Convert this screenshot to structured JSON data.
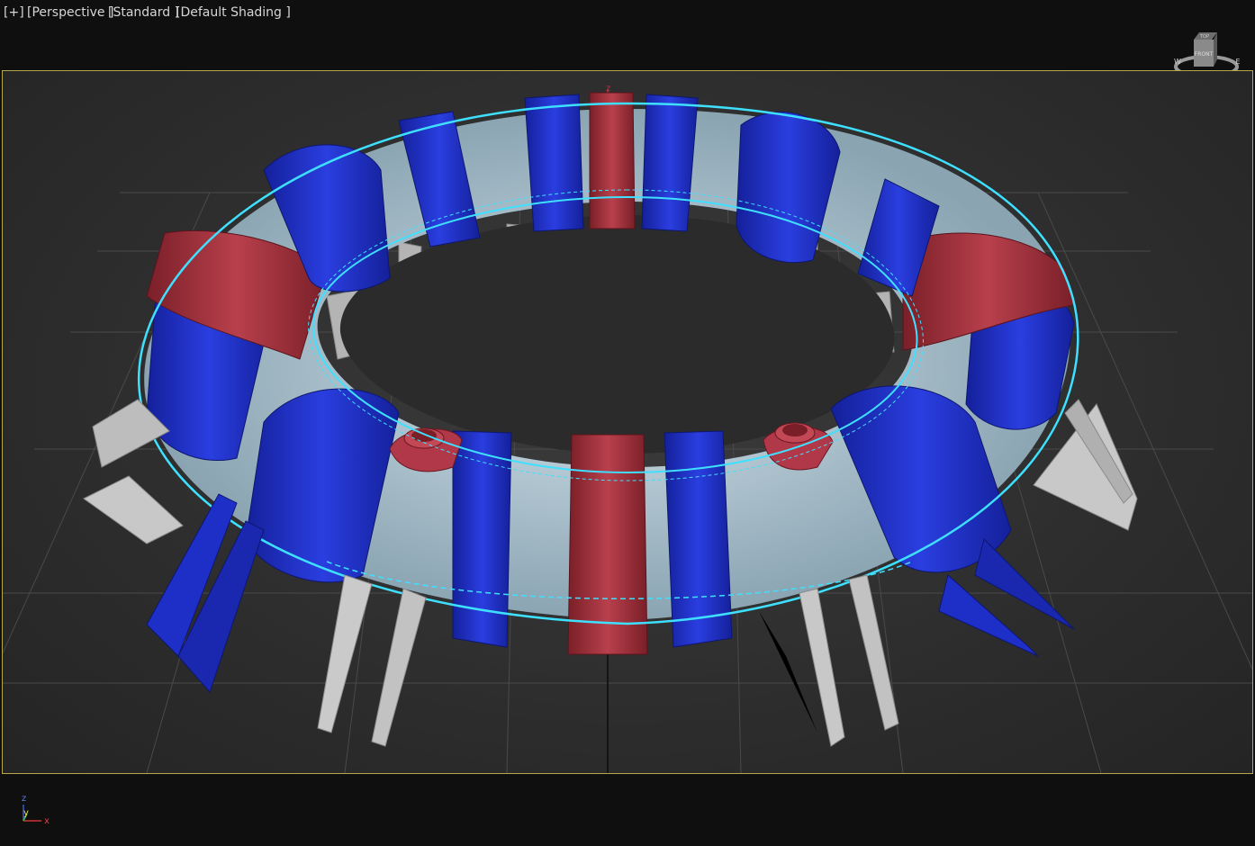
{
  "viewport_labels": {
    "menu": "[+]",
    "view": "[Perspective ]",
    "renderer": "[Standard ]",
    "shading": "[Default Shading ]"
  },
  "viewcube": {
    "face": "FRONT",
    "top_label": "TOP",
    "west": "W",
    "east": "E",
    "south": "S"
  },
  "axes": {
    "x": "x",
    "y": "y",
    "z": "z"
  },
  "scene_axis": {
    "z": "z",
    "x": "x"
  },
  "colors": {
    "viewport_border": "#b8a64a",
    "ring_blue": "#1e2fc8",
    "ring_red": "#a8303c",
    "tube": "#b4ccd6",
    "selection": "#3fe0ff",
    "support": "#c8c8c8"
  }
}
